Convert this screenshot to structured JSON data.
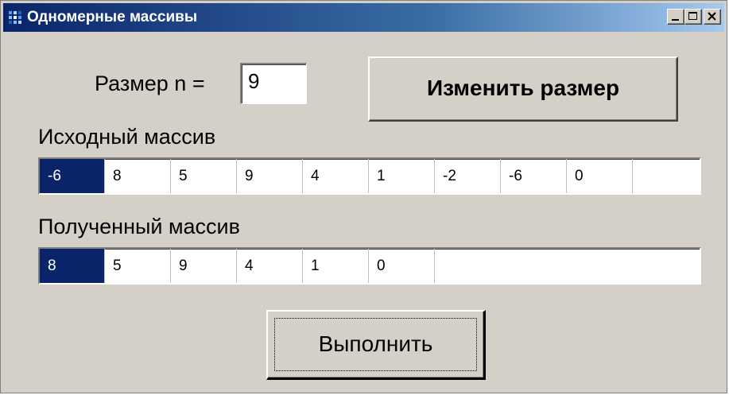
{
  "window": {
    "title": "Одномерные массивы",
    "controls": {
      "minimize": "minimize",
      "maximize": "maximize",
      "close": "close"
    }
  },
  "size": {
    "label": "Размер n =",
    "value": "9"
  },
  "buttons": {
    "resize_label": "Изменить размер",
    "run_label": "Выполнить"
  },
  "source_array": {
    "label": "Исходный массив",
    "cells": [
      "-6",
      "8",
      "5",
      "9",
      "4",
      "1",
      "-2",
      "-6",
      "0"
    ]
  },
  "result_array": {
    "label": "Полученный массив",
    "cells": [
      "8",
      "5",
      "9",
      "4",
      "1",
      "0"
    ]
  },
  "colors": {
    "window_bg": "#d4d0c8",
    "title_start": "#0a246a",
    "title_end": "#a6caf0",
    "selection": "#0a246a"
  }
}
